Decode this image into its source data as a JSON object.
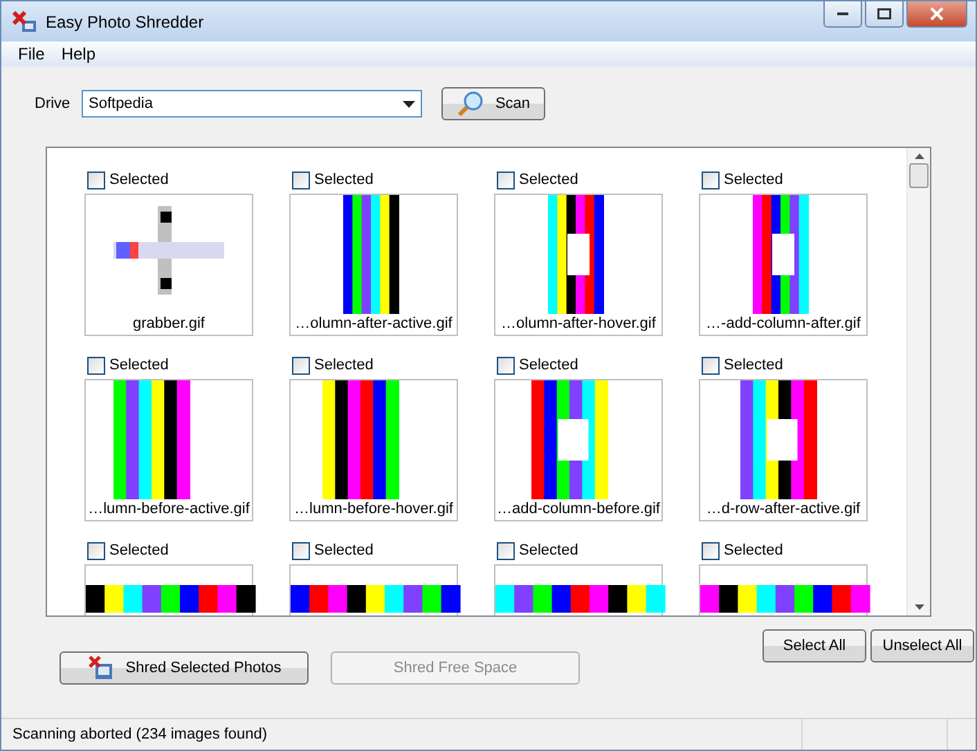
{
  "window": {
    "title": "Easy Photo Shredder"
  },
  "menu": [
    "File",
    "Help"
  ],
  "drive": {
    "label": "Drive",
    "value": "Softpedia"
  },
  "scan_button": "Scan",
  "photos": [
    {
      "label": "Selected",
      "checked": false,
      "filename": "grabber.gif"
    },
    {
      "label": "Selected",
      "checked": false,
      "filename": "…olumn-after-active.gif"
    },
    {
      "label": "Selected",
      "checked": false,
      "filename": "…olumn-after-hover.gif"
    },
    {
      "label": "Selected",
      "checked": false,
      "filename": "…-add-column-after.gif"
    },
    {
      "label": "Selected",
      "checked": false,
      "filename": "…lumn-before-active.gif"
    },
    {
      "label": "Selected",
      "checked": false,
      "filename": "…lumn-before-hover.gif"
    },
    {
      "label": "Selected",
      "checked": false,
      "filename": "…add-column-before.gif"
    },
    {
      "label": "Selected",
      "checked": false,
      "filename": "…d-row-after-active.gif"
    },
    {
      "label": "Selected",
      "checked": false
    },
    {
      "label": "Selected",
      "checked": false
    },
    {
      "label": "Selected",
      "checked": false
    },
    {
      "label": "Selected",
      "checked": false
    }
  ],
  "buttons": [
    {
      "label": "Select All",
      "disabled": false
    },
    {
      "label": "Unselect All",
      "disabled": false
    }
  ],
  "actions": [
    {
      "label": "Shred Selected Photos",
      "disabled": false
    },
    {
      "label": "Shred Free Space",
      "disabled": true
    }
  ],
  "status_bar": "Scanning aborted (234 images found)"
}
